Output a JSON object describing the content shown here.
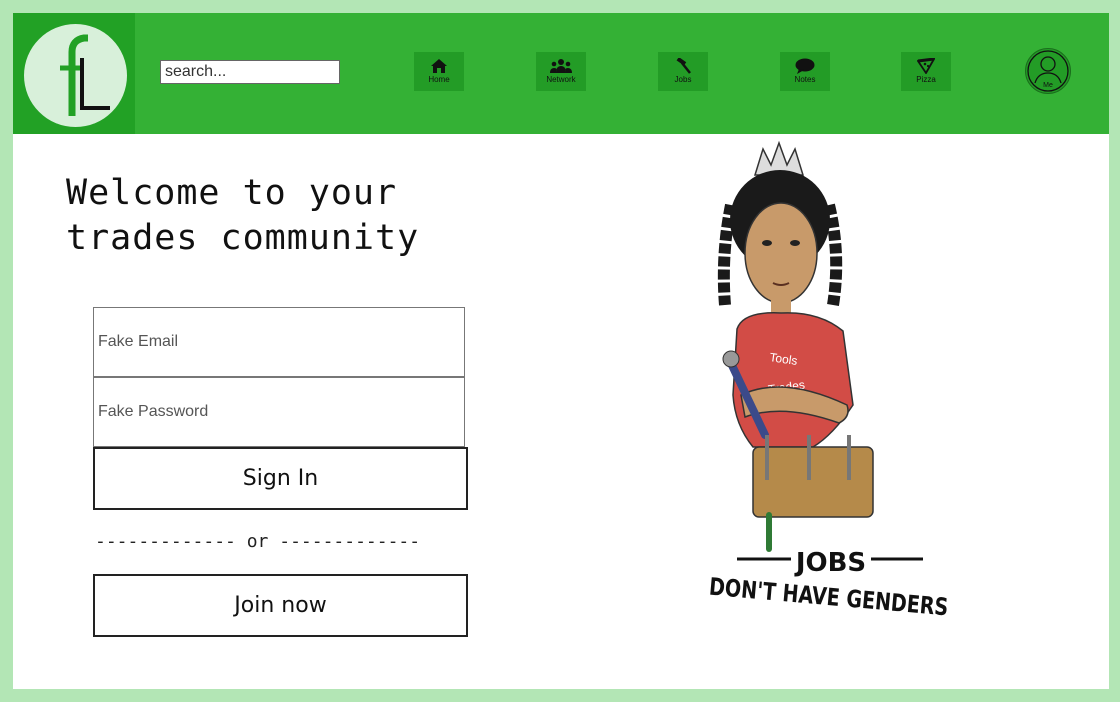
{
  "logo": {
    "text": "fL",
    "icon": "fl-logo-icon"
  },
  "search": {
    "placeholder": "search..."
  },
  "nav": {
    "items": [
      {
        "label": "Home",
        "icon": "home-icon"
      },
      {
        "label": "Network",
        "icon": "people-icon"
      },
      {
        "label": "Jobs",
        "icon": "hammer-icon"
      },
      {
        "label": "Notes",
        "icon": "speech-bubble-icon"
      },
      {
        "label": "Pizza",
        "icon": "pizza-icon"
      }
    ],
    "me": {
      "label": "Me",
      "icon": "user-avatar-icon"
    }
  },
  "main": {
    "welcome_line1": "Welcome to your",
    "welcome_line2": "trades community",
    "email_placeholder": "Fake Email",
    "password_placeholder": "Fake Password",
    "sign_in_label": "Sign In",
    "or_divider": "------------- or -------------",
    "join_label": "Join now"
  },
  "hero": {
    "shirt_text_1": "Tools",
    "shirt_text_2": "Trades",
    "caption_1": "JOBS",
    "caption_2": "DON'T HAVE GENDERS"
  },
  "colors": {
    "page_background": "#b3e6b5",
    "topbar": "#34b135",
    "logo_box": "#22a125",
    "nav_button": "#239c26"
  }
}
